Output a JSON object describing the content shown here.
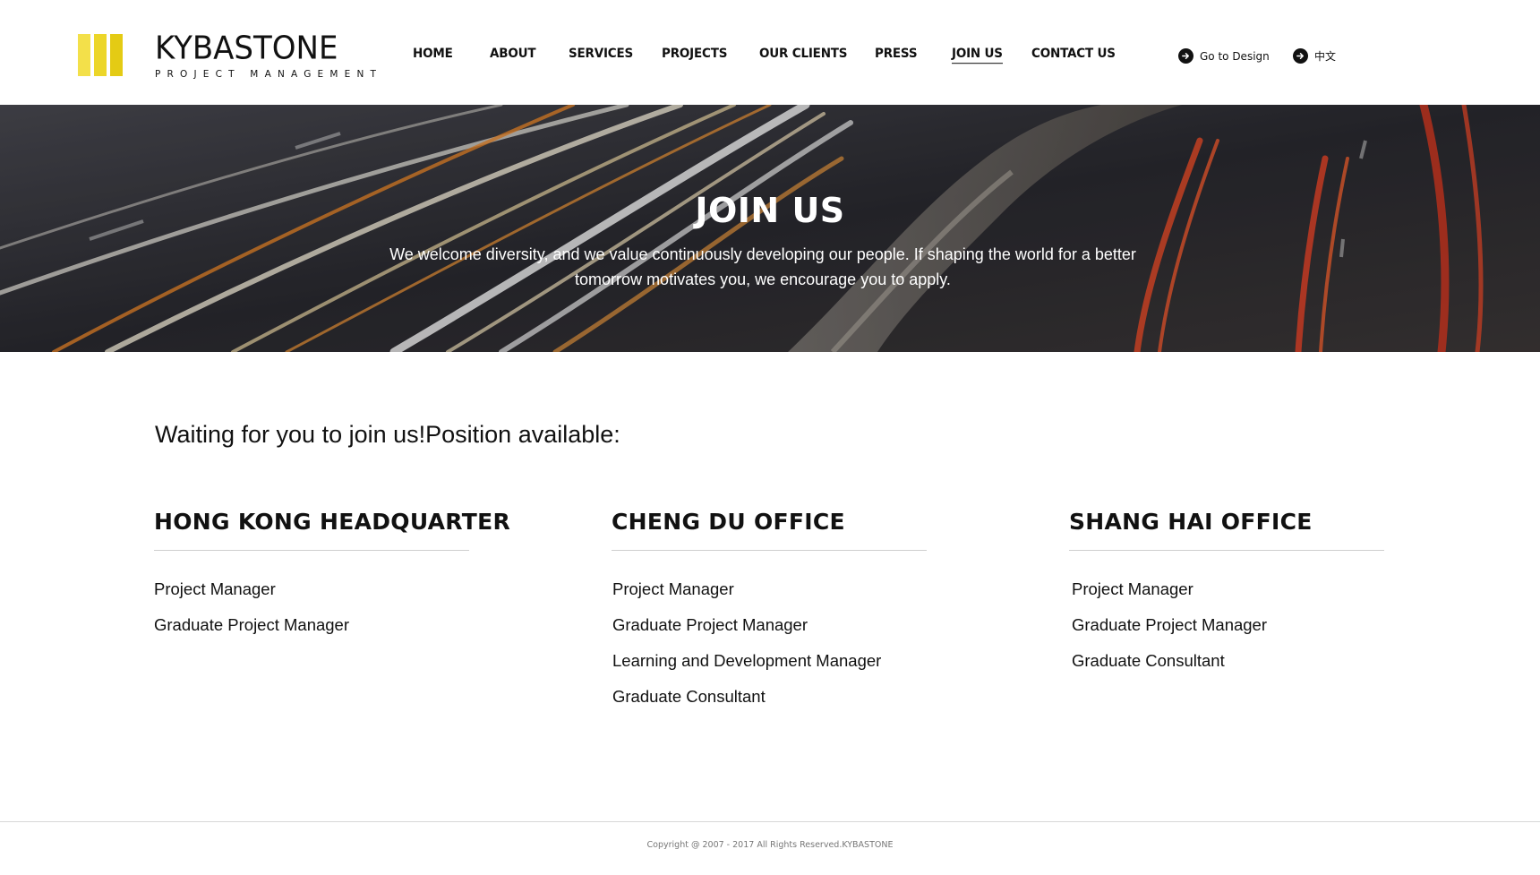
{
  "brand": {
    "name": "KYBASTONE",
    "tagline": "PROJECT MANAGEMENT",
    "colors": [
      "#f3e04a",
      "#ecd629",
      "#e4cb14"
    ]
  },
  "nav": {
    "items": [
      {
        "label": "HOME",
        "active": false
      },
      {
        "label": "ABOUT",
        "active": false
      },
      {
        "label": "SERVICES",
        "active": false
      },
      {
        "label": "PROJECTS",
        "active": false
      },
      {
        "label": "OUR CLIENTS",
        "active": false
      },
      {
        "label": "PRESS",
        "active": false
      },
      {
        "label": "JOIN US",
        "active": true
      },
      {
        "label": "CONTACT US",
        "active": false
      }
    ]
  },
  "header_links": {
    "design": {
      "label": "Go to Design",
      "icon": "arrow-circle-right-icon"
    },
    "language": {
      "label": "中文",
      "icon": "arrow-circle-right-icon"
    }
  },
  "hero": {
    "title": "JOIN US",
    "description": "We welcome diversity, and we value continuously developing our people. If shaping the world for a better tomorrow motivates you, we encourage you to apply."
  },
  "intro": "Waiting for you to join us!Position available:",
  "offices": [
    {
      "name": "HONG KONG HEADQUARTER",
      "positions": [
        "Project Manager",
        "Graduate Project Manager"
      ]
    },
    {
      "name": "CHENG DU OFFICE",
      "positions": [
        "Project Manager",
        "Graduate Project Manager",
        "Learning and Development Manager",
        "Graduate Consultant"
      ]
    },
    {
      "name": "SHANG HAI OFFICE",
      "positions": [
        "Project Manager",
        "Graduate Project Manager",
        "Graduate Consultant"
      ]
    }
  ],
  "footer": {
    "copyright": "Copyright @ 2007 - 2017 All Rights Reserved.KYBASTONE"
  }
}
